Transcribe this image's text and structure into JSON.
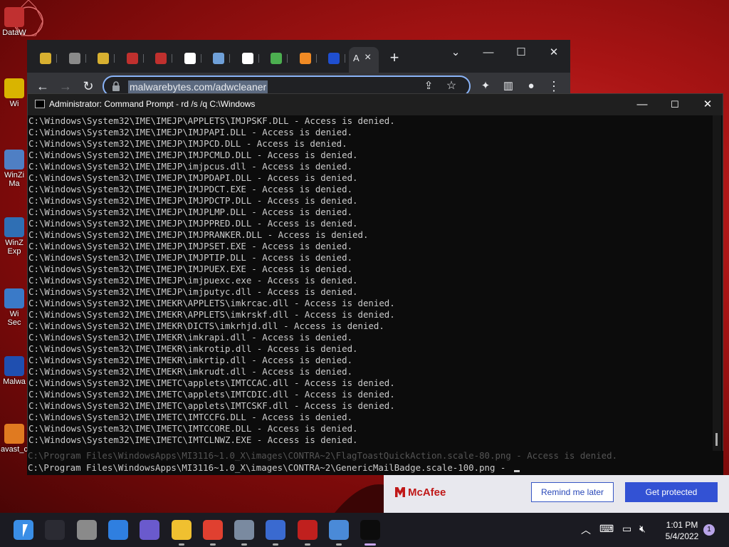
{
  "desktop": {
    "icons": [
      {
        "label": "DataW",
        "color": "#c03030"
      },
      {
        "label": "Wi",
        "color": "#d9b400"
      },
      {
        "label": "WinZi",
        "sub": "Ma",
        "color": "#4f7fc4"
      },
      {
        "label": "WinZ",
        "sub": "Exp",
        "color": "#2f6fb4"
      },
      {
        "label": "Wi",
        "sub": "Sec",
        "color": "#3a7ac8"
      },
      {
        "label": "Malwa",
        "color": "#1f4fb0"
      },
      {
        "label": "avast_c",
        "color": "#e07a20"
      }
    ]
  },
  "browser": {
    "tabs": [
      {
        "color": "#d8b030"
      },
      {
        "color": "#8a8a8a"
      },
      {
        "color": "#d8b030"
      },
      {
        "color": "#c0302e"
      },
      {
        "color": "#c0302e"
      },
      {
        "color": "#ffffff"
      },
      {
        "color": "#6fa0d8"
      },
      {
        "color": "#ffffff"
      },
      {
        "color": "#4caf50"
      },
      {
        "color": "#f08a24"
      },
      {
        "color": "#1f4fd0"
      }
    ],
    "active_tab_letter": "A",
    "url": "malwarebytes.com/adwcleaner"
  },
  "cmd": {
    "title": "Administrator: Command Prompt - rd  /s /q C:\\Windows",
    "lines": [
      "C:\\Windows\\System32\\IME\\IMEJP\\APPLETS\\IMJPSKF.DLL - Access is denied.",
      "C:\\Windows\\System32\\IME\\IMEJP\\IMJPAPI.DLL - Access is denied.",
      "C:\\Windows\\System32\\IME\\IMEJP\\IMJPCD.DLL - Access is denied.",
      "C:\\Windows\\System32\\IME\\IMEJP\\IMJPCMLD.DLL - Access is denied.",
      "C:\\Windows\\System32\\IME\\IMEJP\\imjpcus.dll - Access is denied.",
      "C:\\Windows\\System32\\IME\\IMEJP\\IMJPDAPI.DLL - Access is denied.",
      "C:\\Windows\\System32\\IME\\IMEJP\\IMJPDCT.EXE - Access is denied.",
      "C:\\Windows\\System32\\IME\\IMEJP\\IMJPDCTP.DLL - Access is denied.",
      "C:\\Windows\\System32\\IME\\IMEJP\\IMJPLMP.DLL - Access is denied.",
      "C:\\Windows\\System32\\IME\\IMEJP\\IMJPPRED.DLL - Access is denied.",
      "C:\\Windows\\System32\\IME\\IMEJP\\IMJPRANKER.DLL - Access is denied.",
      "C:\\Windows\\System32\\IME\\IMEJP\\IMJPSET.EXE - Access is denied.",
      "C:\\Windows\\System32\\IME\\IMEJP\\IMJPTIP.DLL - Access is denied.",
      "C:\\Windows\\System32\\IME\\IMEJP\\IMJPUEX.EXE - Access is denied.",
      "C:\\Windows\\System32\\IME\\IMEJP\\imjpuexc.exe - Access is denied.",
      "C:\\Windows\\System32\\IME\\IMEJP\\imjputyc.dll - Access is denied.",
      "C:\\Windows\\System32\\IME\\IMEKR\\APPLETS\\imkrcac.dll - Access is denied.",
      "C:\\Windows\\System32\\IME\\IMEKR\\APPLETS\\imkrskf.dll - Access is denied.",
      "C:\\Windows\\System32\\IME\\IMEKR\\DICTS\\imkrhjd.dll - Access is denied.",
      "C:\\Windows\\System32\\IME\\IMEKR\\imkrapi.dll - Access is denied.",
      "C:\\Windows\\System32\\IME\\IMEKR\\imkrotip.dll - Access is denied.",
      "C:\\Windows\\System32\\IME\\IMEKR\\imkrtip.dll - Access is denied.",
      "C:\\Windows\\System32\\IME\\IMEKR\\imkrudt.dll - Access is denied.",
      "C:\\Windows\\System32\\IME\\IMETC\\applets\\IMTCCAC.dll - Access is denied.",
      "C:\\Windows\\System32\\IME\\IMETC\\applets\\IMTCDIC.dll - Access is denied.",
      "C:\\Windows\\System32\\IME\\IMETC\\applets\\IMTCSKF.dll - Access is denied.",
      "C:\\Windows\\System32\\IME\\IMETC\\IMTCCFG.DLL - Access is denied.",
      "C:\\Windows\\System32\\IME\\IMETC\\IMTCCORE.DLL - Access is denied.",
      "C:\\Windows\\System32\\IME\\IMETC\\IMTCLNWZ.EXE - Access is denied."
    ],
    "tail_ghost": "C:\\Program Files\\WindowsApps\\MI3116~1.0_X\\images\\CONTRA~2\\FlagToastQuickAction.scale-80.png - Access is denied.",
    "tail_current": "C:\\Program Files\\WindowsApps\\MI3116~1.0_X\\images\\CONTRA~2\\GenericMailBadge.scale-100.png - "
  },
  "mcafee": {
    "brand": "McAfee",
    "remind_label": "Remind me later",
    "protect_label": "Get protected"
  },
  "taskbar": {
    "apps": [
      {
        "name": "start",
        "color": "#3a8ee6"
      },
      {
        "name": "search",
        "color": "#2b2b33"
      },
      {
        "name": "task-view",
        "color": "#8a8a8a"
      },
      {
        "name": "widgets",
        "color": "#2f7fe0"
      },
      {
        "name": "chat",
        "color": "#6a5acd"
      },
      {
        "name": "file-explorer",
        "color": "#f0c030"
      },
      {
        "name": "chrome",
        "color": "#e04030"
      },
      {
        "name": "settings",
        "color": "#7a8aa0"
      },
      {
        "name": "app-blue",
        "color": "#3a6ad0"
      },
      {
        "name": "mcafee",
        "color": "#c0201e"
      },
      {
        "name": "app-globe",
        "color": "#4a8ad8"
      },
      {
        "name": "terminal",
        "color": "#0c0c0c"
      }
    ],
    "time": "1:01 PM",
    "date": "5/4/2022",
    "notifications": "1"
  }
}
